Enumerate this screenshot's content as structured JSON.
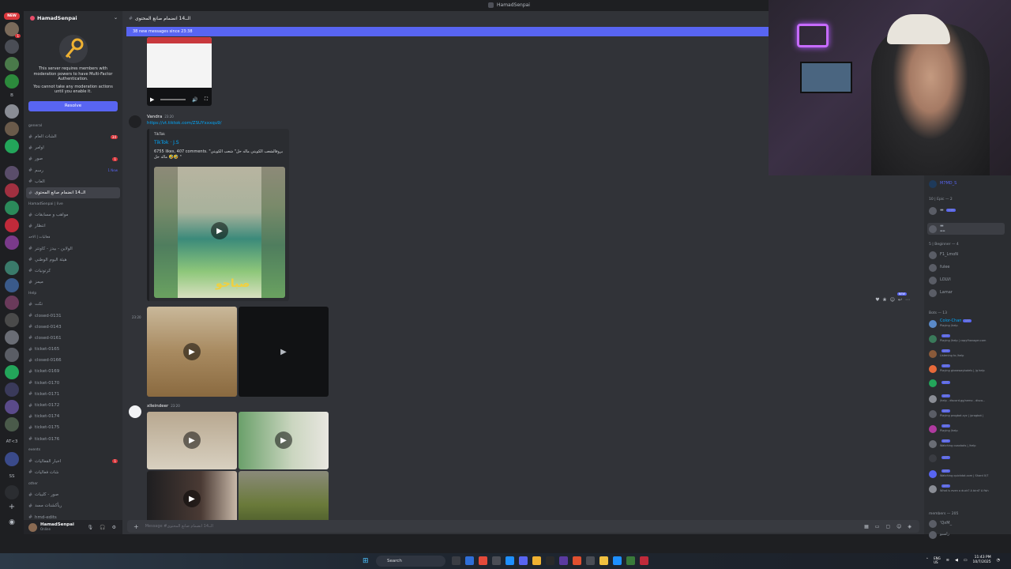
{
  "window": {
    "title": "HamadSenpai"
  },
  "rail": {
    "new_badge": "NEW",
    "letter_b": "B",
    "letter_ss": "SS",
    "atlt3": "AT<3"
  },
  "server": {
    "name": "HamadSenpai"
  },
  "mfa": {
    "line1": "This server requires members with moderation powers to have Multi-Factor Authentication.",
    "line2": "You cannot take any moderation actions until you enable it.",
    "resolve": "Resolve"
  },
  "channels": {
    "cat_general": "general",
    "items": [
      {
        "name": "الشات العام",
        "badge": "34"
      },
      {
        "name": "اوامر",
        "badge": ""
      },
      {
        "name": "صور",
        "badge": "1"
      },
      {
        "name": "رسم",
        "badge": "",
        "new": "1 New"
      },
      {
        "name": "العاب",
        "badge": ""
      },
      {
        "name": "الــ14 انضمام صانع المحتوى",
        "badge": "",
        "active": true
      }
    ],
    "cat_voice": "HamadSenpai | live",
    "voice": [
      {
        "name": "مواهب و مسابقات"
      },
      {
        "name": "انتظار"
      }
    ],
    "cat_events": "فعاليات | الاحد",
    "events": [
      {
        "name": "الولاين - بيدز - كاونتر"
      },
      {
        "name": "هيئة اليوم الوطني"
      },
      {
        "name": "كرتونيات"
      },
      {
        "name": "ميمز"
      }
    ],
    "cat_help": "Help",
    "help_first": "تكت",
    "tickets": [
      "closed-0131",
      "closed-0143",
      "closed-0161",
      "ticket-0165",
      "closed-0166",
      "ticket-0169",
      "ticket-0170",
      "ticket-0171",
      "ticket-0172",
      "ticket-0174",
      "ticket-0175",
      "ticket-0176"
    ],
    "cat_events2": "events",
    "ev2": [
      {
        "name": "اخبار الفعاليات",
        "badge": "1"
      },
      {
        "name": "شات فعاليات",
        "badge": ""
      }
    ],
    "cat_other": "other",
    "other": [
      "صور - كليبات",
      "ريأكشنات مسد",
      "hmd-edits"
    ]
  },
  "user": {
    "name": "HamadSenpai",
    "status": "Online"
  },
  "chat": {
    "channel_title": "الــ14 انضمام صانع المحتوى",
    "new_messages": "38 new messages since 23:38",
    "msg1": {
      "author": "Vandra",
      "time": "23:20",
      "link": "https://vt.tiktok.com/ZSUYxxxqu9/"
    },
    "embed": {
      "provider": "TikTok",
      "title": "TikTok · J.S",
      "desc": "6755 likes, 407 comments. \"بروفالشعب الكويتي ماله حل\" شعب الكويتي ماله حل 🤣🤣 \""
    },
    "thumb_text": "صباحو",
    "msg2": {
      "time": "23:20"
    },
    "msg3": {
      "author": "xlleindeer",
      "time": "23:20"
    },
    "composer_placeholder": "Message #الــ14 انضمام صانع المحتوى"
  },
  "members": {
    "owner": "M7MD_S",
    "cat_epic": "10 | Epic — 2",
    "cat_beginner": "5 | Beginner — 4",
    "beginner": [
      "F1_LmoN",
      "fulee",
      "LOLVI",
      "Lamar"
    ],
    "cat_bots": "Bots — 13",
    "bots": [
      {
        "name": "Color-Chan",
        "tag": "APP",
        "sub": "Playing /help"
      },
      {
        "name": "",
        "tag": "APP",
        "sub": "Playing /help | copyfhanager.com"
      },
      {
        "name": "",
        "tag": "APP",
        "sub": "Listening to /help"
      },
      {
        "name": "",
        "tag": "APP",
        "sub": "Playing giveawaybotels | /g help"
      },
      {
        "name": "",
        "tag": "APP",
        "sub": ""
      },
      {
        "name": "",
        "tag": "APP",
        "sub": "/help - discord.gg/nemo - disco..."
      },
      {
        "name": "",
        "tag": "APP",
        "sub": "Playing progbot.xyz | /progbot |"
      },
      {
        "name": "",
        "tag": "APP",
        "sub": "Playing /help"
      },
      {
        "name": "",
        "tag": "APP",
        "sub": "Watching coaxbots | /help"
      },
      {
        "name": "",
        "tag": "APP",
        "sub": ""
      },
      {
        "name": "",
        "tag": "APP",
        "sub": "Watching quickdot.com | Shard 0/7"
      },
      {
        "name": "",
        "tag": "APP",
        "sub": "What is even a duck? A bird? A fish"
      }
    ],
    "cat_members": "members — 205",
    "m1": "'QxM_",
    "m2": "راسبو"
  },
  "taskbar": {
    "search": "Search",
    "lang": "ENG",
    "lang2": "US",
    "time": "11:43 PM",
    "date": "10/7/2025"
  },
  "colors": {
    "accent": "#5865f2",
    "bg": "#313338",
    "sidebar": "#2b2d31"
  }
}
